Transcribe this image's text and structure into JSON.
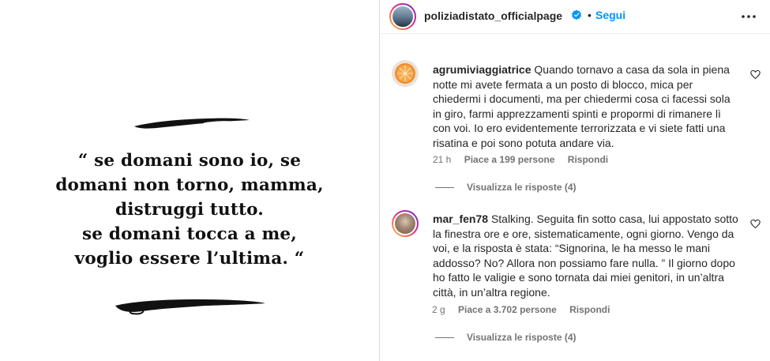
{
  "post": {
    "quote_lines": [
      "“ se domani sono io, se",
      "domani non torno, mamma,",
      "distruggi tutto.",
      "se domani tocca a me,",
      "voglio essere l’ultima. “"
    ]
  },
  "header": {
    "username": "poliziadistato_officialpage",
    "dot": "•",
    "follow_label": "Segui",
    "more_icon": "more-horizontal-icon"
  },
  "comments": [
    {
      "username": "agrumiviaggiatrice",
      "text": "Quando tornavo a casa da sola in piena notte mi avete fermata a un posto di blocco, mica per chiedermi i documenti, ma per chiedermi cosa ci facessi sola in giro, farmi apprezzamenti spinti e propormi di rimanere lì con voi. Io ero evidentemente terrorizzata e vi siete fatti una risatina e poi sono potuta andare via.",
      "time": "21 h",
      "likes": "Piace a 199 persone",
      "reply_label": "Rispondi",
      "view_replies": "Visualizza le risposte (4)"
    },
    {
      "username": "mar_fen78",
      "text": "Stalking. Seguita fin sotto casa, lui appostato sotto la finestra ore e ore, sistematicamente, ogni giorno. Vengo da voi, e la risposta è stata: “Signorina, le ha messo le mani addosso? No? Allora non possiamo fare nulla. ” Il giorno dopo ho fatto le valigie e sono tornata dai miei genitori, in un’altra città, in un’altra regione.",
      "time": "2 g",
      "likes": "Piace a 3.702 persone",
      "reply_label": "Rispondi",
      "view_replies": "Visualizza le risposte (4)"
    }
  ],
  "colors": {
    "link": "#0095f6",
    "verified": "#0095f6",
    "muted": "#737373"
  }
}
